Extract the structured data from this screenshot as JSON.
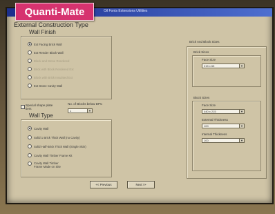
{
  "brand": "Quanti-Mate",
  "window": {
    "menu_text": "Oil Fonts    Extensions   Utilities"
  },
  "external": {
    "title": "External Construction Type",
    "wall_finish_title": "Wall Finish",
    "wall_finish_options": [
      {
        "label": "Ext Facing Brick Wall",
        "selected": true,
        "enabled": true
      },
      {
        "label": "Ext Render Block Wall",
        "selected": false,
        "enabled": true
      },
      {
        "label": "Block and Stone Rendered",
        "selected": false,
        "enabled": false
      },
      {
        "label": "Brick with Block Rendered Ext",
        "selected": false,
        "enabled": false
      },
      {
        "label": "Block with Brick Insulated Ext",
        "selected": false,
        "enabled": false
      },
      {
        "label": "Ext Stone Cavity Wall",
        "selected": false,
        "enabled": true
      }
    ]
  },
  "special": {
    "checkbox_label": "Special shape plate tiers",
    "blocks_label": "No. of Blocks below DPC",
    "blocks_value": "1"
  },
  "wall_type": {
    "title": "Wall Type",
    "options": [
      {
        "label": "Cavity Wall",
        "selected": true
      },
      {
        "label": "Solid 1 Brick Thick Wall (no Cavity)",
        "selected": false
      },
      {
        "label": "Solid Half-Brick Thick Wall (Single Skin)",
        "selected": false
      },
      {
        "label": "Cavity Wall Timber Frame Kit",
        "selected": false
      },
      {
        "label": "Cavity Wall Timber Frame Made on Site",
        "selected": false
      }
    ]
  },
  "block_size": {
    "outer_title": "Brick And Block Sizes",
    "brick_group_title": "Brick Sizes",
    "brick_face_label": "Face Size",
    "brick_face_value": "215 x 65",
    "block_group_title": "Block Sizes",
    "block_face_label": "Face Size",
    "block_face_value": "440 x 215",
    "ext_thickness_label": "External Thickness",
    "ext_thickness_value": "100",
    "int_thickness_label": "Internal Thickness",
    "int_thickness_value": "100"
  },
  "nav": {
    "previous_label": "<< Previous",
    "next_label": "Next >>"
  }
}
